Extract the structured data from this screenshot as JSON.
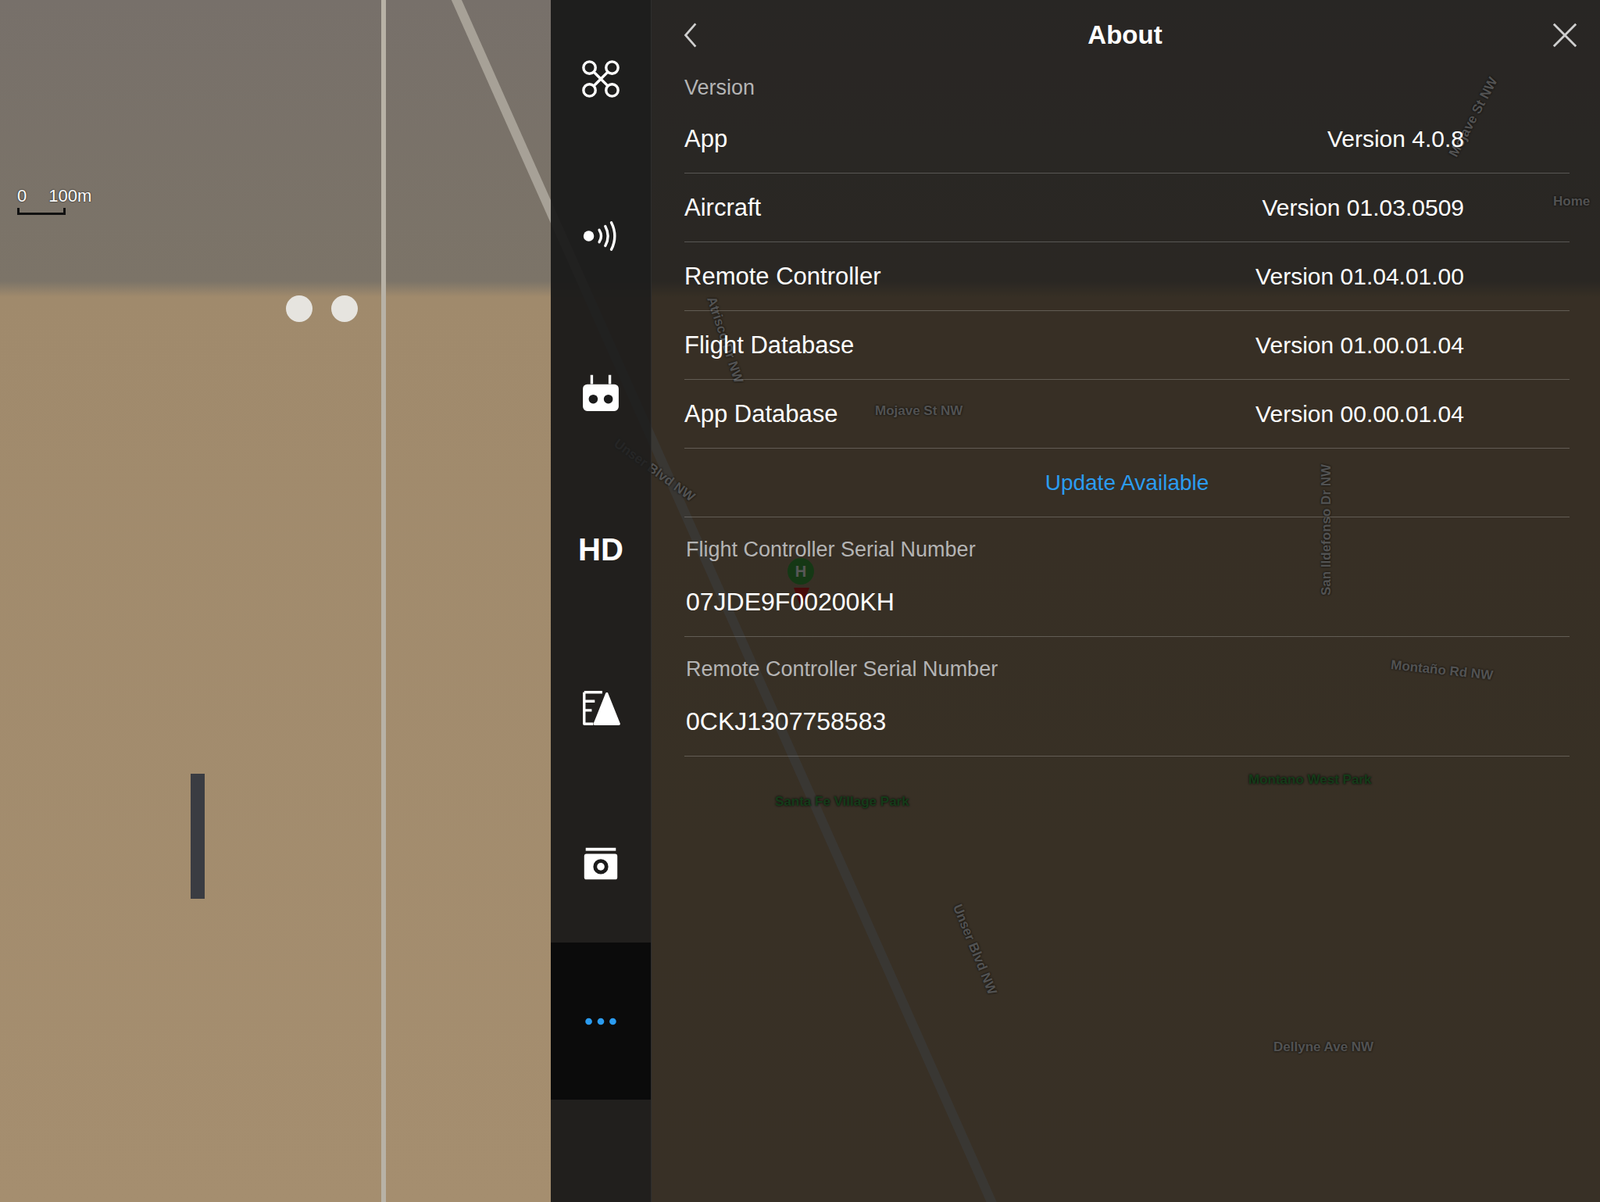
{
  "map": {
    "scale": {
      "start": "0",
      "end": "100m"
    },
    "labels": [
      {
        "text": "Mojave St NW"
      },
      {
        "text": "Home"
      },
      {
        "text": "Atrisco Dr NW"
      },
      {
        "text": "Mojave St NW"
      },
      {
        "text": "Unser Blvd NW"
      },
      {
        "text": "San Ildefonso Dr NW"
      },
      {
        "text": "Montaño Rd NW"
      },
      {
        "text": "Montano West Park"
      },
      {
        "text": "Santa Fe Village Park"
      },
      {
        "text": "Unser Blvd NW"
      },
      {
        "text": "Dellyne Ave NW"
      }
    ],
    "home_marker": {
      "label": "H"
    }
  },
  "sidebar": {
    "items": [
      {
        "selected": false
      },
      {
        "selected": false
      },
      {
        "selected": false
      },
      {
        "label": "HD",
        "selected": false
      },
      {
        "selected": false
      },
      {
        "selected": false
      },
      {
        "selected": true
      }
    ]
  },
  "panel": {
    "title": "About",
    "section": "Version",
    "rows": [
      {
        "label": "App",
        "value": "Version 4.0.8"
      },
      {
        "label": "Aircraft",
        "value": "Version 01.03.0509"
      },
      {
        "label": "Remote Controller",
        "value": "Version 01.04.01.00"
      },
      {
        "label": "Flight Database",
        "value": "Version 01.00.01.04"
      },
      {
        "label": "App Database",
        "value": "Version 00.00.01.04"
      }
    ],
    "update_link": "Update Available",
    "serials": [
      {
        "label": "Flight Controller Serial Number",
        "value": "07JDE9F00200KH"
      },
      {
        "label": "Remote Controller Serial Number",
        "value": "0CKJ1307758583"
      }
    ]
  }
}
